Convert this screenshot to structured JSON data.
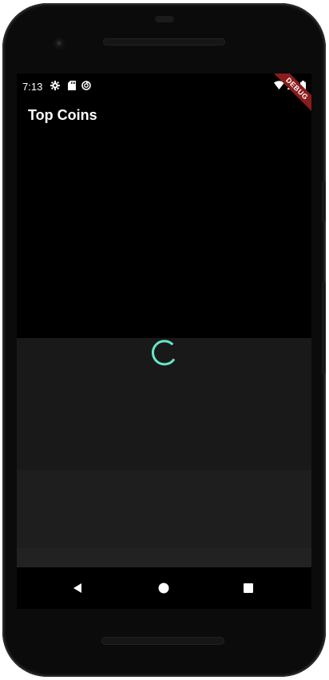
{
  "status_bar": {
    "time": "7:13",
    "left_icons": [
      "settings-icon",
      "sd-card-icon",
      "sync-icon"
    ],
    "right_icons": [
      "wifi-icon",
      "signal-icon",
      "battery-icon"
    ]
  },
  "app_bar": {
    "title": "Top Coins"
  },
  "debug_banner": {
    "label": "DEBUG"
  },
  "loading": {
    "spinner_color": "#64e6c8",
    "state": "loading"
  },
  "nav_bar": {
    "buttons": [
      "back-icon",
      "home-icon",
      "recents-icon"
    ]
  },
  "colors": {
    "background": "#000000",
    "panel_1": "#191919",
    "panel_2": "#1e1e1e",
    "panel_3": "#222222",
    "accent": "#64e6c8",
    "debug": "#8b1c1c"
  }
}
